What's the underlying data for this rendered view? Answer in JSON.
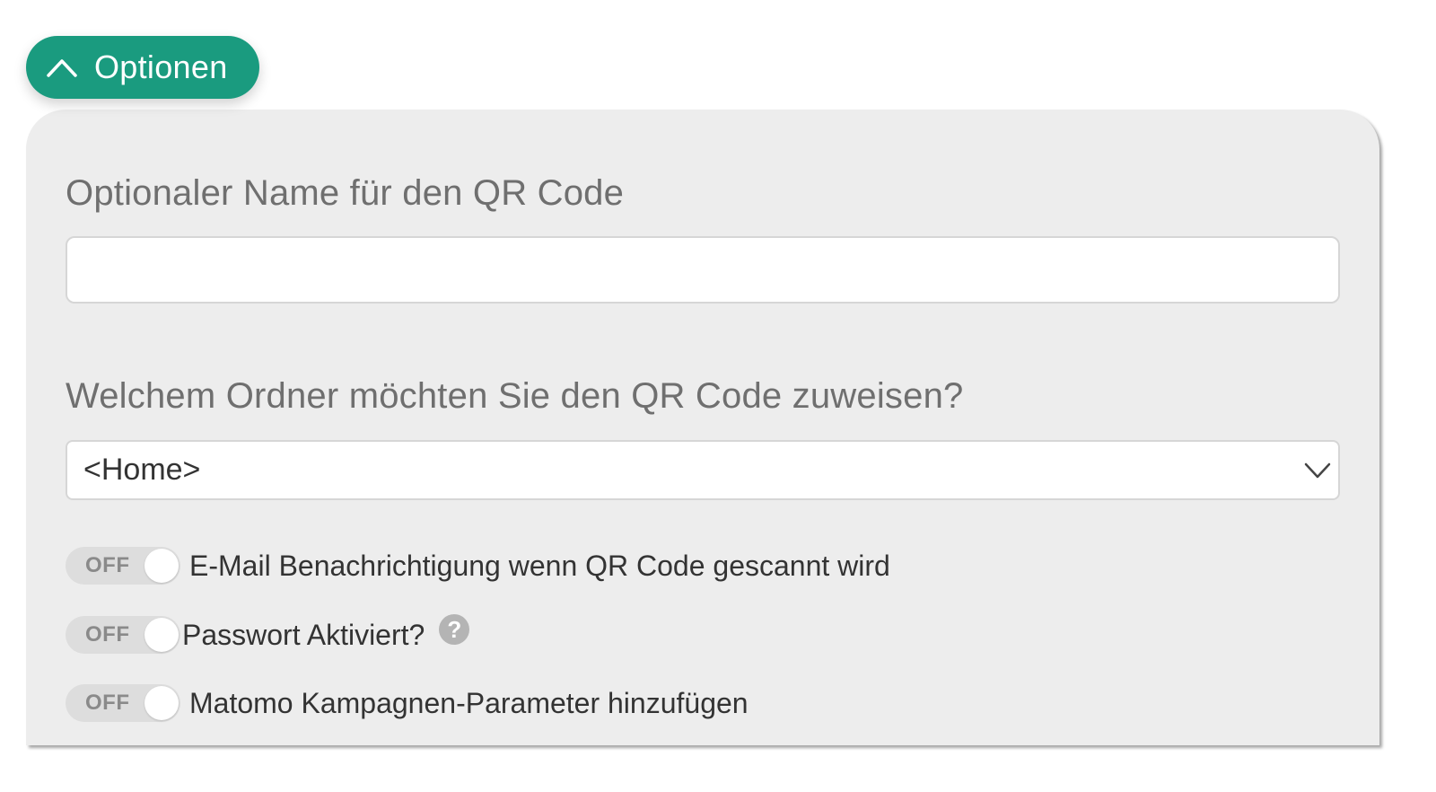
{
  "options_button": {
    "label": "Optionen",
    "icon": "chevron-up-icon",
    "color": "#1a9b7f"
  },
  "form": {
    "name_field": {
      "label": "Optionaler Name für den QR Code",
      "value": "",
      "placeholder": ""
    },
    "folder_field": {
      "label": "Welchem Ordner möchten Sie den QR Code zuweisen?",
      "selected": "<Home>",
      "icon": "chevron-down-icon"
    },
    "toggles": [
      {
        "state": "OFF",
        "label": "E-Mail Benachrichtigung wenn QR Code gescannt wird"
      },
      {
        "state": "OFF",
        "label": "Passwort Aktiviert?",
        "help_icon": "question-circle-icon"
      },
      {
        "state": "OFF",
        "label": "Matomo Kampagnen-Parameter hinzufügen"
      }
    ]
  }
}
